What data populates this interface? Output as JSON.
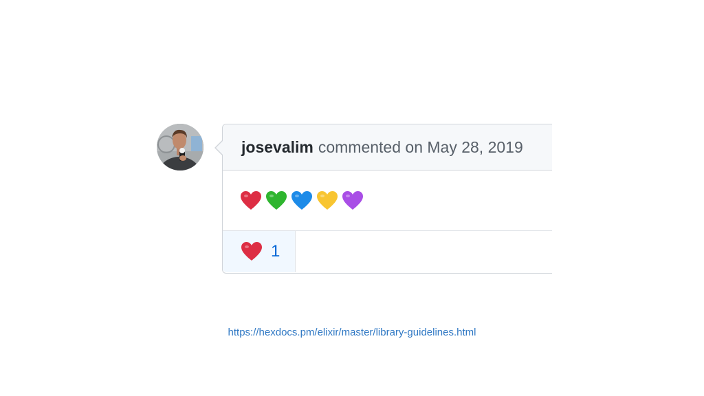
{
  "comment": {
    "author": "josevalim",
    "action_text": "commented on May 28, 2019",
    "avatar_icon": "user-avatar",
    "body_hearts": [
      {
        "icon": "red-heart-icon",
        "color": "#dd2e44"
      },
      {
        "icon": "green-heart-icon",
        "color": "#2fb52f"
      },
      {
        "icon": "blue-heart-icon",
        "color": "#1d8be8"
      },
      {
        "icon": "yellow-heart-icon",
        "color": "#f8c531"
      },
      {
        "icon": "purple-heart-icon",
        "color": "#a94ee6"
      }
    ],
    "reaction": {
      "icon": "red-heart-icon",
      "count": "1"
    }
  },
  "footer": {
    "link_text": "https://hexdocs.pm/elixir/master/library-guidelines.html"
  },
  "colors": {
    "header_bg": "#f6f8fa",
    "border": "#d1d5da",
    "reaction_bg": "#f1f8ff",
    "reaction_count": "#0366d6",
    "link": "#2f78c4"
  }
}
